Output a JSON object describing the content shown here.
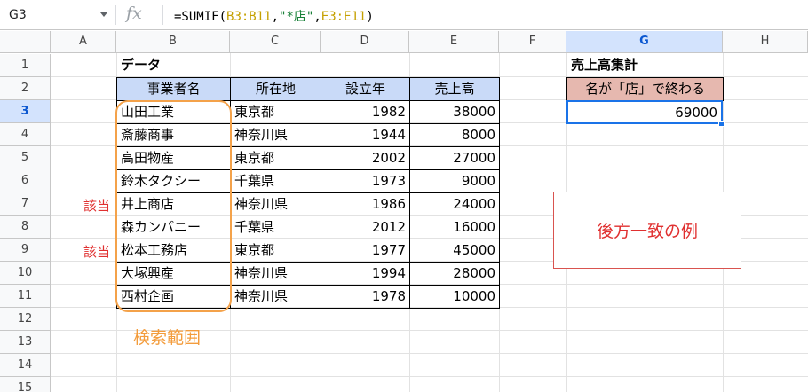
{
  "formula_bar": {
    "name_box": "G3",
    "fx_label": "fx",
    "formula_prefix": "=SUMIF(",
    "formula_ref1": "B3:B11",
    "formula_comma1": ",",
    "formula_string": "\"*店\"",
    "formula_comma2": ",",
    "formula_ref2": "E3:E11",
    "formula_suffix": ")"
  },
  "columns": [
    "A",
    "B",
    "C",
    "D",
    "E",
    "F",
    "G",
    "H"
  ],
  "rows": [
    "1",
    "2",
    "3",
    "4",
    "5",
    "6",
    "7",
    "8",
    "9",
    "10",
    "11",
    "12",
    "13",
    "14",
    "15"
  ],
  "table": {
    "title": "データ",
    "headers": [
      "事業者名",
      "所在地",
      "設立年",
      "売上高"
    ],
    "records": [
      [
        "山田工業",
        "東京都",
        "1982",
        "38000"
      ],
      [
        "斎藤商事",
        "神奈川県",
        "1944",
        "8000"
      ],
      [
        "高田物産",
        "東京都",
        "2002",
        "27000"
      ],
      [
        "鈴木タクシー",
        "千葉県",
        "1973",
        "9000"
      ],
      [
        "井上商店",
        "神奈川県",
        "1986",
        "24000"
      ],
      [
        "森カンパニー",
        "千葉県",
        "2012",
        "16000"
      ],
      [
        "松本工務店",
        "東京都",
        "1977",
        "45000"
      ],
      [
        "大塚興産",
        "神奈川県",
        "1994",
        "28000"
      ],
      [
        "西村企画",
        "神奈川県",
        "1978",
        "10000"
      ]
    ]
  },
  "summary": {
    "title": "売上高集計",
    "condition_label": "名が「店」で終わる",
    "result": "69000"
  },
  "annotations": {
    "search_range_label": "検索範囲",
    "match_label_row7": "該当",
    "match_label_row9": "該当",
    "note": "後方一致の例"
  },
  "colors": {
    "header_fill": "#c9daf8",
    "summary_header_fill": "#e6b8af",
    "range_outline": "#f4a24a",
    "annotation_red": "#e03030",
    "selection_blue": "#1a73e8"
  }
}
